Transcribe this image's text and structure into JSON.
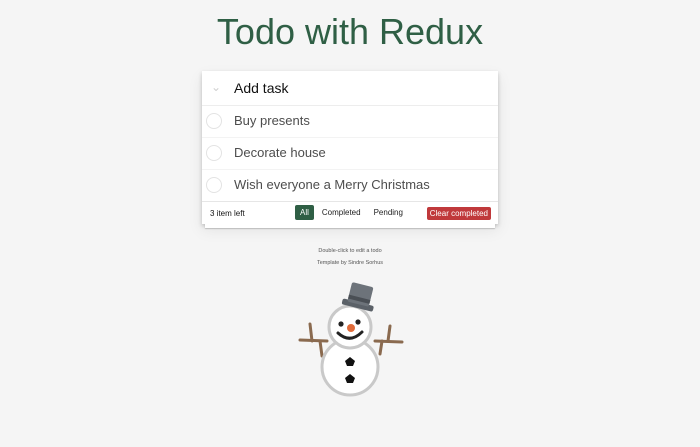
{
  "header": {
    "title": "Todo with Redux"
  },
  "new_todo": {
    "placeholder": "Add task",
    "toggle_icon": "chevron-down-icon"
  },
  "todos": [
    {
      "label": "Buy presents",
      "completed": false
    },
    {
      "label": "Decorate house",
      "completed": false
    },
    {
      "label": "Wish everyone a Merry Christmas",
      "completed": false
    }
  ],
  "footer": {
    "count_text": "3 item left",
    "filters": [
      "All",
      "Completed",
      "Pending"
    ],
    "selected_filter": "All",
    "clear_label": "Clear completed"
  },
  "info": {
    "hint": "Double-click to edit a todo",
    "credit": "Template by Sindre Sorhus"
  },
  "colors": {
    "accent": "#2f5f45",
    "danger": "#c0393b",
    "background": "#f5f5f5"
  },
  "illustration": {
    "icon": "snowman-icon"
  }
}
